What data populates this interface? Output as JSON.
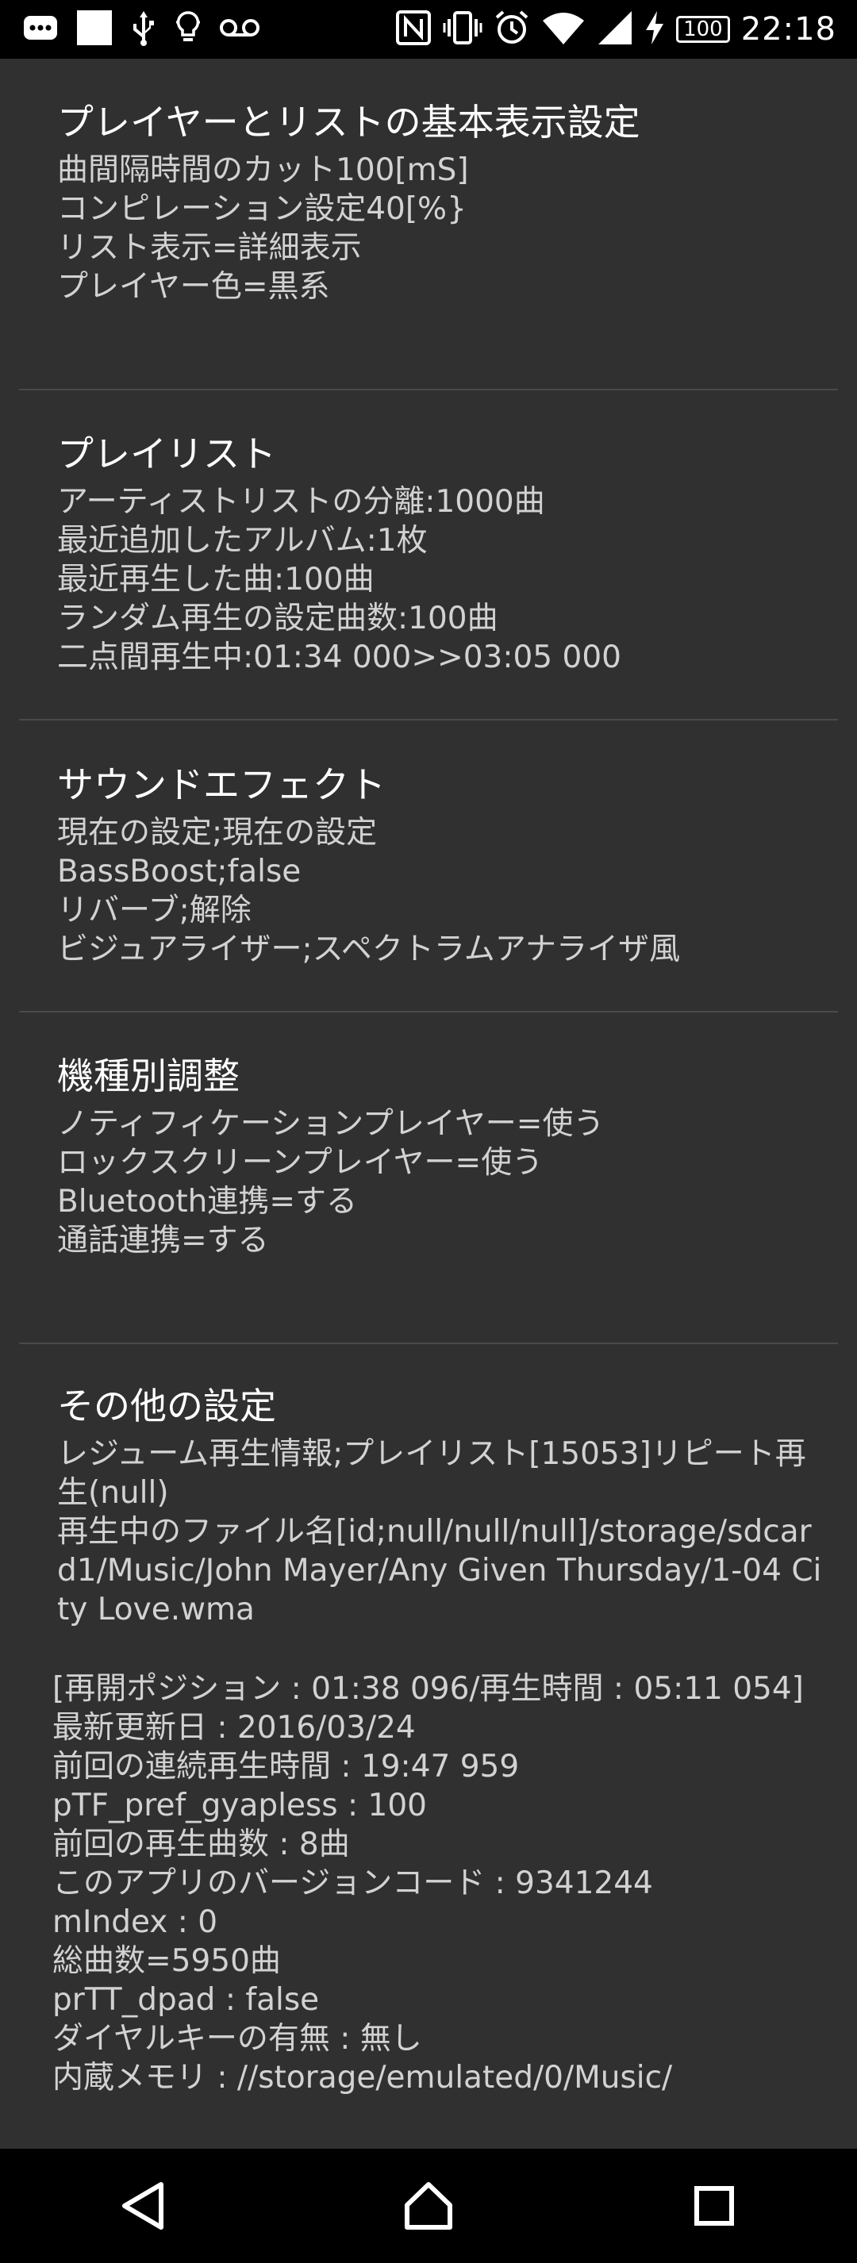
{
  "status_bar": {
    "battery": "100",
    "time": "22:18",
    "icons_left": [
      "message-icon",
      "image-icon",
      "usb-icon",
      "lightbulb-icon",
      "voicemail-icon"
    ],
    "icons_right": [
      "nfc-icon",
      "vibrate-icon",
      "alarm-icon",
      "wifi-icon",
      "signal-icon",
      "charging-icon",
      "battery-icon"
    ]
  },
  "sections": [
    {
      "title": "プレイヤーとリストの基本表示設定",
      "lines": [
        "曲間隔時間のカット100[mS]",
        "コンピレーション設定40[%}",
        "リスト表示=詳細表示",
        "プレイヤー色=黒系"
      ]
    },
    {
      "title": "プレイリスト",
      "lines": [
        "アーティストリストの分離:1000曲",
        "最近追加したアルバム:1枚",
        "最近再生した曲:100曲",
        "ランダム再生の設定曲数:100曲",
        "二点間再生中:01:34 000>>03:05 000"
      ]
    },
    {
      "title": "サウンドエフェクト",
      "lines": [
        "現在の設定;現在の設定",
        "BassBoost;false",
        "リバーブ;解除",
        "ビジュアライザー;スペクトラムアナライザ風"
      ]
    },
    {
      "title": "機種別調整",
      "lines": [
        "ノティフィケーションプレイヤー=使う",
        "ロックスクリーンプレイヤー=使う",
        "Bluetooth連携=する",
        "通話連携=する"
      ]
    },
    {
      "title": "その他の設定",
      "lines": [
        "レジューム再生情報;プレイリスト[15053]リピート再生(null)",
        "再生中のファイル名[id;null/null/null]/storage/sdcard1/Music/John Mayer/Any Given Thursday/1-04 City Love.wma"
      ]
    }
  ],
  "info_lines": [
    "[再開ポジション : 01:38 096/再生時間 : 05:11 054]",
    "最新更新日 : 2016/03/24",
    "前回の連続再生時間 : 19:47 959",
    "pTF_pref_gyapless : 100",
    "前回の再生曲数 : 8曲",
    "このアプリのバージョンコード : 9341244",
    "mIndex : 0",
    "総曲数=5950曲",
    "prTT_dpad : false",
    "ダイヤルキーの有無 : 無し",
    "内蔵メモリ : //storage/emulated/0/Music/"
  ],
  "nav": {
    "icons": [
      "back-icon",
      "home-icon",
      "recents-icon"
    ]
  }
}
